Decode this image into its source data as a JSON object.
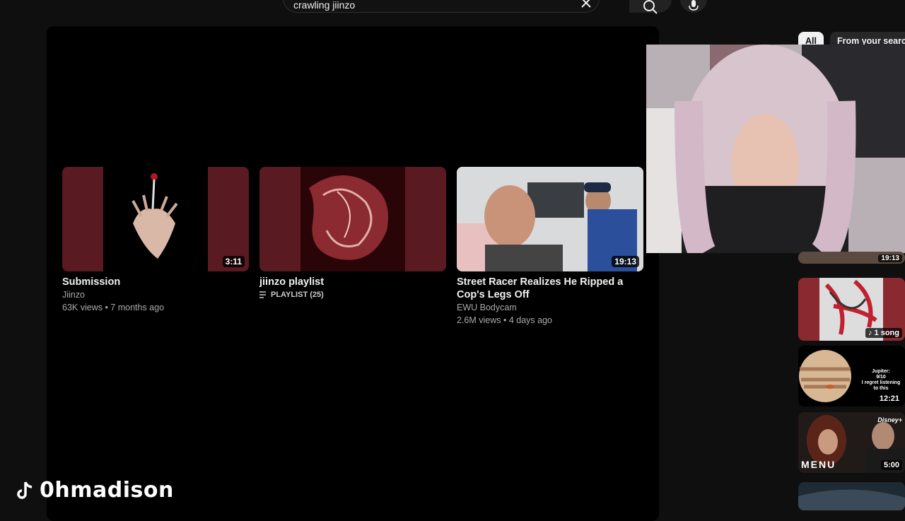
{
  "search": {
    "query": "crawling jiinzo",
    "clear_icon": "close-icon",
    "search_icon": "search-icon",
    "mic_icon": "mic-icon"
  },
  "end_screen": {
    "videos": [
      {
        "title": "Submission",
        "channel": "Jiinzo",
        "stats": "63K views • 7 months ago",
        "duration": "3:11",
        "accent": "#5a1a22"
      },
      {
        "title": "jiinzo playlist",
        "playlist_label": "PLAYLIST (25)",
        "accent": "#5a1a22"
      },
      {
        "title": "Street Racer Realizes He Ripped a Cop's Legs Off",
        "channel": "EWU Bodycam",
        "stats": "2.6M views • 4 days ago",
        "duration": "19:13"
      }
    ]
  },
  "chips": {
    "all": "All",
    "from_search": "From your search"
  },
  "sidebar": {
    "items": [
      {
        "badge": "19:13"
      },
      {
        "badge": "1 song"
      },
      {
        "badge": "12:21",
        "thumb_text_1": "Jupiter:",
        "thumb_text_2": "9/10",
        "thumb_text_3": "I regret listening to this"
      },
      {
        "badge": "5:00",
        "thumb_text": "MENU",
        "logo": "Disney+"
      },
      {
        "badge": ""
      }
    ]
  },
  "watermark": {
    "name": "0hmadison",
    "icon": "tiktok-icon"
  }
}
